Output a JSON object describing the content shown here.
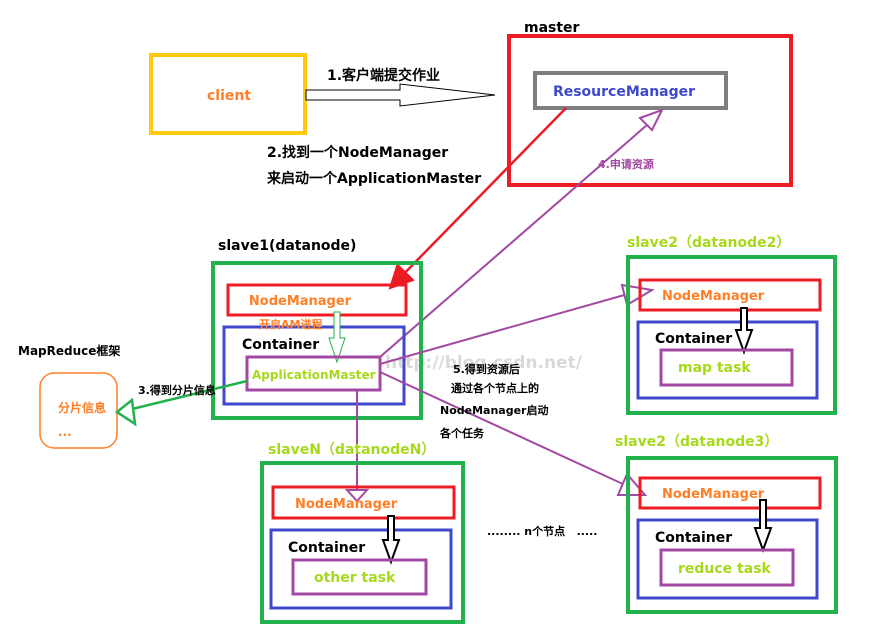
{
  "colors": {
    "green": "#22b14c",
    "red": "#ed1c24",
    "blue": "#3f48cc",
    "purple": "#a349a4",
    "orange": "#ff7f27",
    "yellow": "#ffc90e",
    "lime": "#a8d81c",
    "grey": "#7f7f7f"
  },
  "client": {
    "label": "client"
  },
  "master": {
    "title": "master",
    "resource_manager": "ResourceManager"
  },
  "steps": {
    "s1": "1.客户端提交作业",
    "s2a": "2.找到一个NodeManager",
    "s2b": "来启动一个ApplicationMaster",
    "s3": "3.得到分片信息",
    "s4": "4.申请资源",
    "s5a": "5.得到资源后",
    "s5b": "通过各个节点上的",
    "s5c": "NodeManager启动",
    "s5d": "各个任务"
  },
  "mapreduce": {
    "title": "MapReduce框架",
    "split_info": "分片信息",
    "ellipsis": "..."
  },
  "slave1": {
    "title": "slave1(datanode)",
    "node_manager": "NodeManager",
    "start_am": "开启AM进程",
    "container": "Container",
    "app_master": "ApplicationMaster"
  },
  "slave2": {
    "title": "slave2（datanode2）",
    "node_manager": "NodeManager",
    "container": "Container",
    "task": "map task"
  },
  "slave3": {
    "title": "slave2（datanode3）",
    "node_manager": "NodeManager",
    "container": "Container",
    "task": "reduce task"
  },
  "slaveN": {
    "title": "slaveN（datanodeN）",
    "node_manager": "NodeManager",
    "container": "Container",
    "task": "other task"
  },
  "n_nodes": "........ n个节点   .....",
  "watermark": "http://blog.csdn.net/"
}
